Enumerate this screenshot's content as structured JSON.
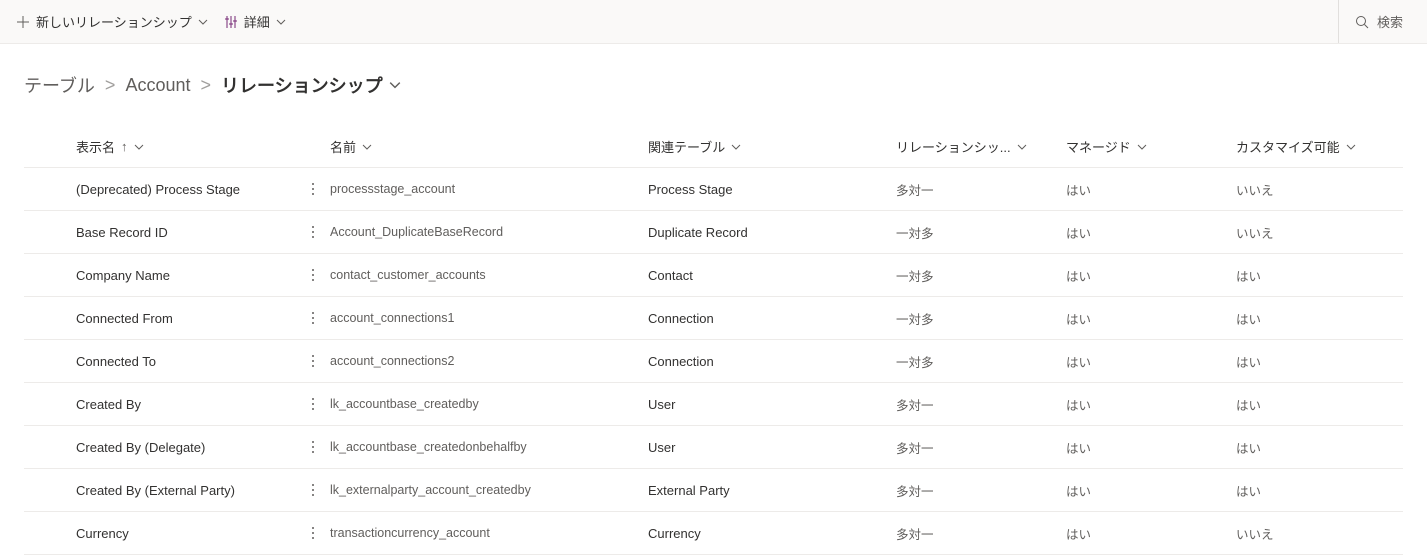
{
  "toolbar": {
    "new_relationship_label": "新しいリレーションシップ",
    "details_label": "詳細",
    "search_label": "検索"
  },
  "breadcrumb": {
    "items": [
      {
        "label": "テーブル"
      },
      {
        "label": "Account"
      }
    ],
    "current": "リレーションシップ"
  },
  "columns": {
    "display_name": "表示名",
    "name": "名前",
    "related_table": "関連テーブル",
    "relationship_type": "リレーションシッ...",
    "managed": "マネージド",
    "customizable": "カスタマイズ可能"
  },
  "rows": [
    {
      "display": "(Deprecated) Process Stage",
      "name": "processstage_account",
      "related": "Process Stage",
      "type": "多対一",
      "managed": "はい",
      "custom": "いいえ"
    },
    {
      "display": "Base Record ID",
      "name": "Account_DuplicateBaseRecord",
      "related": "Duplicate Record",
      "type": "一対多",
      "managed": "はい",
      "custom": "いいえ"
    },
    {
      "display": "Company Name",
      "name": "contact_customer_accounts",
      "related": "Contact",
      "type": "一対多",
      "managed": "はい",
      "custom": "はい"
    },
    {
      "display": "Connected From",
      "name": "account_connections1",
      "related": "Connection",
      "type": "一対多",
      "managed": "はい",
      "custom": "はい"
    },
    {
      "display": "Connected To",
      "name": "account_connections2",
      "related": "Connection",
      "type": "一対多",
      "managed": "はい",
      "custom": "はい"
    },
    {
      "display": "Created By",
      "name": "lk_accountbase_createdby",
      "related": "User",
      "type": "多対一",
      "managed": "はい",
      "custom": "はい"
    },
    {
      "display": "Created By (Delegate)",
      "name": "lk_accountbase_createdonbehalfby",
      "related": "User",
      "type": "多対一",
      "managed": "はい",
      "custom": "はい"
    },
    {
      "display": "Created By (External Party)",
      "name": "lk_externalparty_account_createdby",
      "related": "External Party",
      "type": "多対一",
      "managed": "はい",
      "custom": "はい"
    },
    {
      "display": "Currency",
      "name": "transactioncurrency_account",
      "related": "Currency",
      "type": "多対一",
      "managed": "はい",
      "custom": "いいえ"
    }
  ]
}
